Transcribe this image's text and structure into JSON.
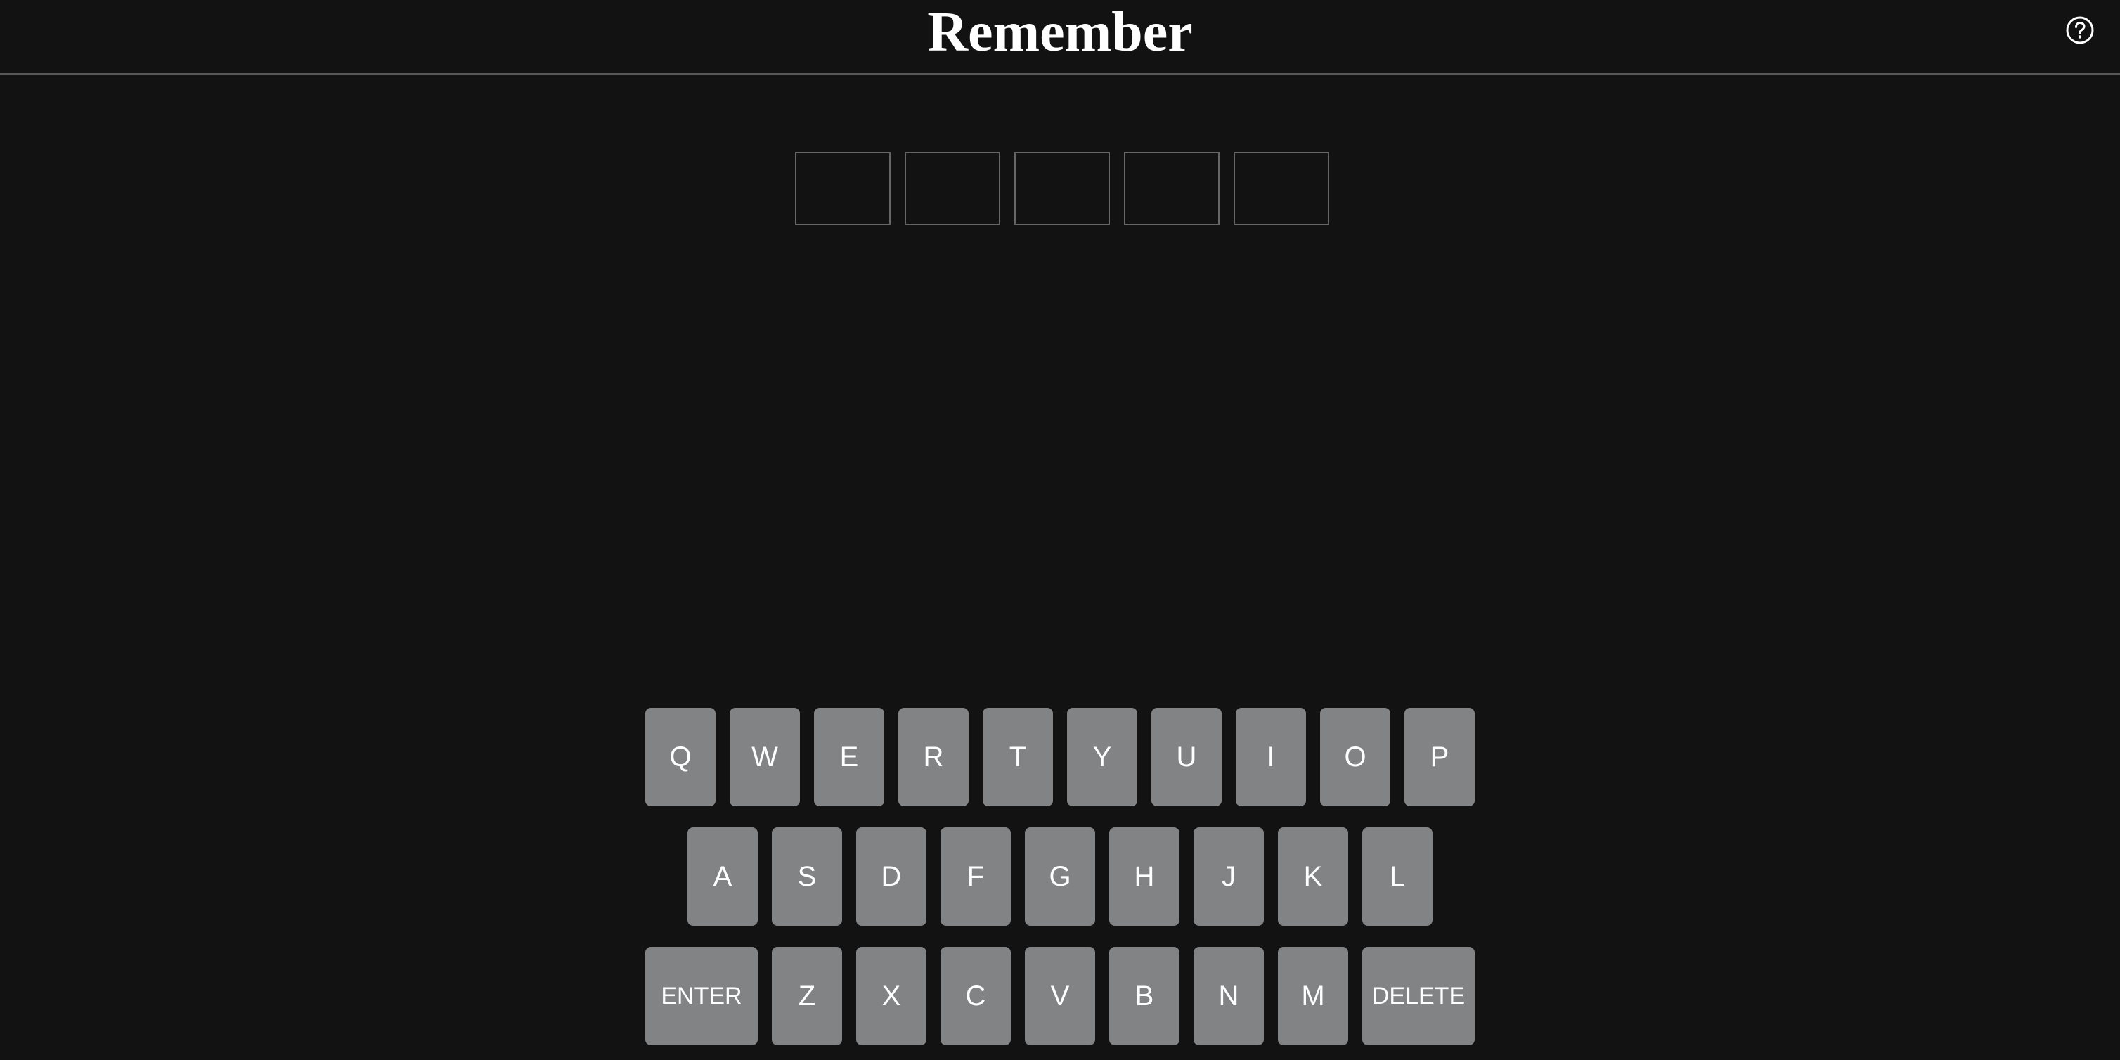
{
  "header": {
    "title": "Remember",
    "help_icon": "question-circle-icon"
  },
  "board": {
    "tiles": [
      "",
      "",
      "",
      "",
      ""
    ]
  },
  "keyboard": {
    "row1": [
      "Q",
      "W",
      "E",
      "R",
      "T",
      "Y",
      "U",
      "I",
      "O",
      "P"
    ],
    "row2": [
      "A",
      "S",
      "D",
      "F",
      "G",
      "H",
      "J",
      "K",
      "L"
    ],
    "row3": [
      "ENTER",
      "Z",
      "X",
      "C",
      "V",
      "B",
      "N",
      "M",
      "DELETE"
    ]
  },
  "colors": {
    "background": "#121212",
    "key": "#818384",
    "tile_border": "#666666",
    "header_border": "#565758"
  }
}
